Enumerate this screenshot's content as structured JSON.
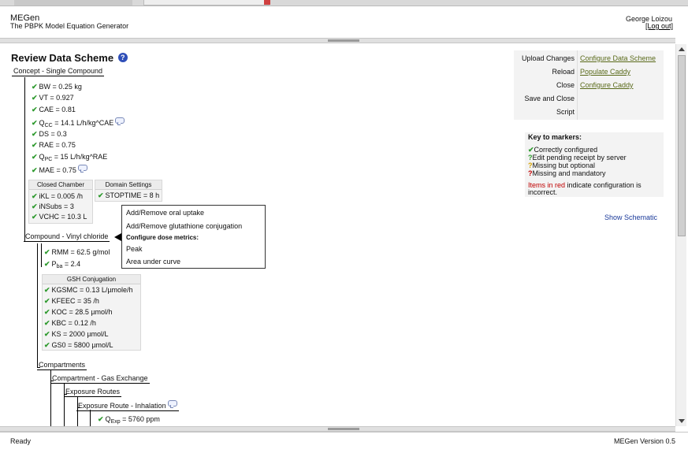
{
  "header": {
    "app_title": "MEGen",
    "app_subtitle": "The PBPK Model Equation Generator",
    "user_name": "George Loizou",
    "logout": "[Log out]"
  },
  "page_title": "Review Data Scheme",
  "tree": {
    "concept": "Concept - Single Compound",
    "concept_params": {
      "bw": "BW = 0.25 kg",
      "vt": "VT = 0.927",
      "cae": "CAE = 0.81",
      "qcc_pre": "Q",
      "qcc_sub": "CC",
      "qcc_post": " = 14.1 L/h/kg^CAE",
      "ds": "DS = 0.3",
      "rae": "RAE = 0.75",
      "qpc_pre": "Q",
      "qpc_sub": "PC",
      "qpc_post": " = 15 L/h/kg^RAE",
      "mae": "MAE = 0.75"
    },
    "closed_chamber": {
      "title": "Closed Chamber",
      "ikl": "iKL = 0.005 /h",
      "insubs": "iNSubs = 3",
      "vchc": "VCHC = 10.3 L"
    },
    "domain_settings": {
      "title": "Domain Settings",
      "stoptime": "STOPTIME = 8 h"
    },
    "compound": "Compound - Vinyl chloride",
    "compound_params": {
      "rmm": "RMM = 62.5 g/mol",
      "pba_pre": "P",
      "pba_sub": "ba",
      "pba_post": " = 2.4"
    },
    "gsh": {
      "title": "GSH Conjugation",
      "kgsmc": "KGSMC = 0.13 L/µmole/h",
      "kfeec": "KFEEC = 35 /h",
      "koc": "KOC = 28.5 µmol/h",
      "kbc": "KBC = 0.12 /h",
      "ks": "KS = 2000 µmol/L",
      "gs0": "GS0 = 5800 µmol/L"
    },
    "compartments": "Compartments",
    "compartment_gas": "Compartment - Gas Exchange",
    "exposure_routes": "Exposure Routes",
    "exposure_inhalation": "Exposure Route - Inhalation",
    "qexp_pre": "Q",
    "qexp_sub": "Exp",
    "qexp_post": " = 5760 ppm"
  },
  "popup_menu": {
    "item1": "Add/Remove oral uptake",
    "item2": "Add/Remove glutathione conjugation",
    "section": "Configure dose metrics:",
    "item3": "Peak",
    "item4": "Area under curve"
  },
  "actions": {
    "upload_changes": "Upload Changes",
    "reload": "Reload",
    "close": "Close",
    "save_and_close": "Save and Close",
    "script": "Script",
    "configure_data_scheme": "Configure Data Scheme",
    "populate_caddy": "Populate Caddy",
    "configure_caddy": "Configure Caddy"
  },
  "key": {
    "title": "Key to markers:",
    "correct": "Correctly configured",
    "pending": "Edit pending receipt by server",
    "optional": "Missing but optional",
    "mandatory": "Missing and mandatory",
    "red_label": "Items in red",
    "red_rest": " indicate configuration is",
    "red_rest2": "incorrect."
  },
  "show_schematic": "Show Schematic",
  "status": {
    "left": "Ready",
    "right": "MEGen Version 0.5"
  },
  "colors": {
    "check": "#2e9a2e",
    "pending": "#2e9a2e",
    "optional": "#d4a000",
    "mandatory": "#c00000",
    "link": "#5a6a1a"
  }
}
